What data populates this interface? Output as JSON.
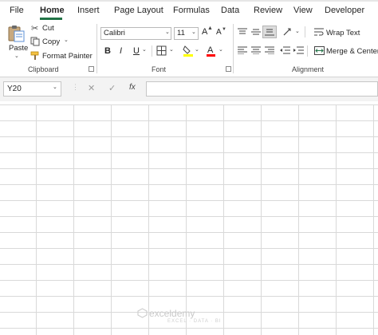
{
  "tabs": [
    {
      "label": "File",
      "active": false
    },
    {
      "label": "Home",
      "active": true
    },
    {
      "label": "Insert",
      "active": false
    },
    {
      "label": "Page Layout",
      "active": false
    },
    {
      "label": "Formulas",
      "active": false
    },
    {
      "label": "Data",
      "active": false
    },
    {
      "label": "Review",
      "active": false
    },
    {
      "label": "View",
      "active": false
    },
    {
      "label": "Developer",
      "active": false
    }
  ],
  "clipboard": {
    "paste_label": "Paste",
    "cut_label": "Cut",
    "copy_label": "Copy",
    "format_painter_label": "Format Painter",
    "group_label": "Clipboard"
  },
  "font": {
    "font_name": "Calibri",
    "font_size": "11",
    "bold_label": "B",
    "italic_label": "I",
    "underline_label": "U",
    "grow_label": "A",
    "shrink_label": "A",
    "group_label": "Font",
    "fill_color": "#ffff00",
    "font_color": "#ff0000"
  },
  "alignment": {
    "wrap_text_label": "Wrap Text",
    "merge_center_label": "Merge & Center",
    "group_label": "Alignment"
  },
  "formula_bar": {
    "name_box_value": "Y20",
    "cancel_symbol": "✕",
    "enter_symbol": "✓",
    "fx_label": "fx",
    "formula_value": ""
  },
  "watermark": {
    "brand": "exceldemy",
    "tagline": "EXCEL · DATA · BI"
  },
  "colors": {
    "accent": "#217346"
  }
}
